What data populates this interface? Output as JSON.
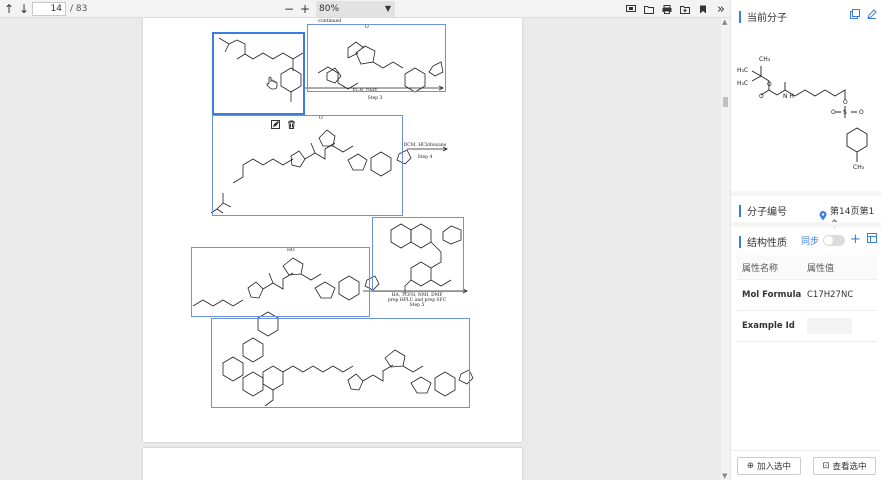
{
  "toolbar": {
    "page_current": "14",
    "page_total": "/ 83",
    "zoom": "80%"
  },
  "document": {
    "continued_label": "-continued",
    "step3_reagents": "Et₃N, DMF",
    "step3_label": "Step 3",
    "step4_reagents": "DCM, HCl/dioxane",
    "step4_label": "Step 4",
    "step5_reagents": "HA, TCFH, NMI, DMF",
    "step5_reagents2": "prep HPLC and prep SFC",
    "step5_label": "Step 5",
    "mol_label_a": "O",
    "mol_label_b": "O",
    "mol_label_c": "HO"
  },
  "panel": {
    "current_molecule_title": "当前分子",
    "molecule_id_title": "分子编号",
    "page_location": "第14页第1个",
    "structure_props_title": "结构性质",
    "sync_label": "同步",
    "props_header_name": "属性名称",
    "props_header_value": "属性值",
    "rows": [
      {
        "name": "Mol Formula",
        "value": "C17H27NC"
      },
      {
        "name": "Example Id",
        "value": ""
      }
    ],
    "add_button": "加入选中",
    "view_button": "查看选中"
  },
  "preview": {
    "atoms": {
      "h3c_top": "CH₃",
      "h3c_left1": "H₃C",
      "h3c_left2": "H₃C",
      "o1": "O",
      "o2": "O",
      "nh": "N\nH",
      "o3": "O",
      "s": "S",
      "o4": "O",
      "o5": "O",
      "ch3_bottom": "CH₃"
    }
  }
}
